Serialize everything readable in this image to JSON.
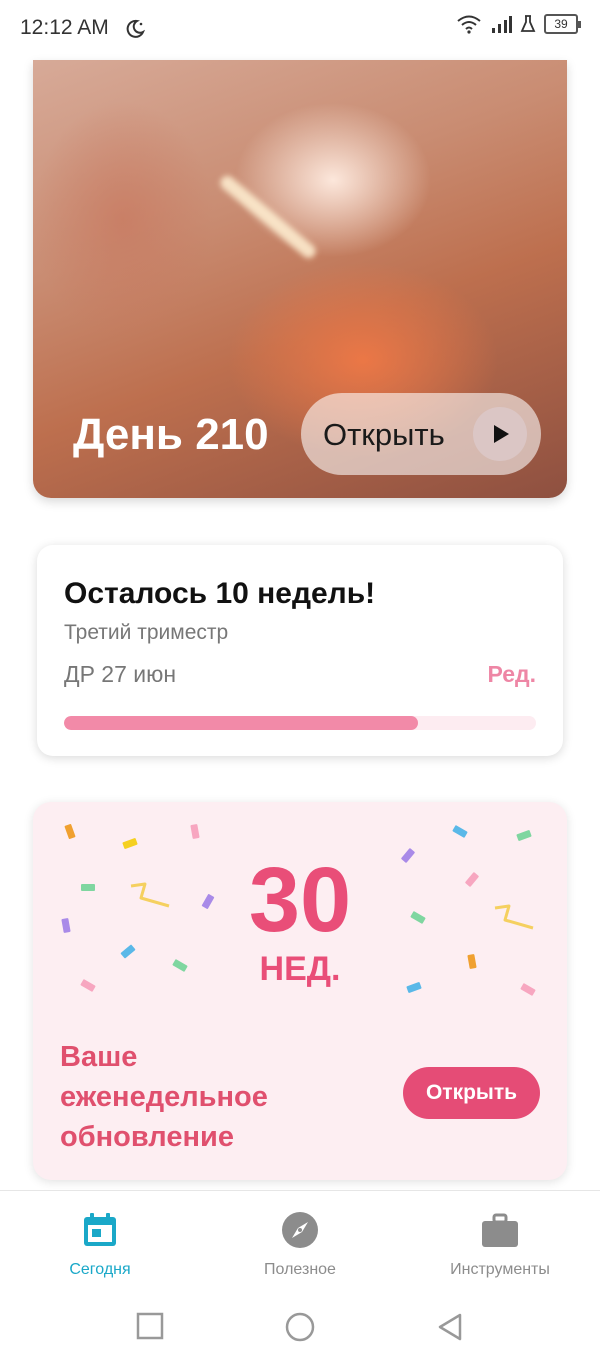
{
  "status_bar": {
    "time": "12:12 AM",
    "battery": "39"
  },
  "hero": {
    "day_label": "День 210",
    "open_label": "Открыть"
  },
  "countdown": {
    "title": "Осталось 10 недель!",
    "trimester": "Третий триместр",
    "due_date": "ДР 27 июн",
    "edit_label": "Ред.",
    "progress": 0.75
  },
  "weekly": {
    "week_number": "30",
    "week_unit": "НЕД.",
    "text": "Ваше еженедельное обновление",
    "open_label": "Открыть"
  },
  "bottom_nav": {
    "items": [
      {
        "label": "Сегодня",
        "active": true
      },
      {
        "label": "Полезное",
        "active": false
      },
      {
        "label": "Инструменты",
        "active": false
      }
    ]
  },
  "colors": {
    "accent_pink": "#e54c76",
    "accent_cyan": "#1aa8c8",
    "progress": "#f28aa8"
  }
}
